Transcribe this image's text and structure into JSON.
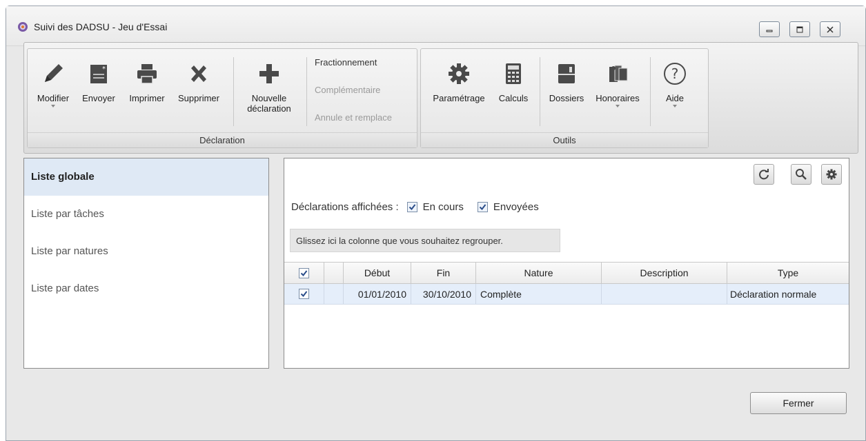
{
  "window": {
    "title": "Suivi des DADSU - Jeu d'Essai"
  },
  "ribbon": {
    "declaration_group": {
      "label": "Déclaration",
      "modifier": "Modifier",
      "envoyer": "Envoyer",
      "imprimer": "Imprimer",
      "supprimer": "Supprimer",
      "nouvelle_line1": "Nouvelle",
      "nouvelle_line2": "déclaration",
      "fractionnement": "Fractionnement",
      "complementaire": "Complémentaire",
      "annule_remplace": "Annule et remplace"
    },
    "outils_group": {
      "label": "Outils",
      "parametrage": "Paramétrage",
      "calculs": "Calculs",
      "dossiers": "Dossiers",
      "honoraires": "Honoraires",
      "aide": "Aide"
    }
  },
  "left_list": {
    "items": [
      {
        "label": "Liste globale",
        "active": true
      },
      {
        "label": "Liste par tâches",
        "active": false
      },
      {
        "label": "Liste par natures",
        "active": false
      },
      {
        "label": "Liste par dates",
        "active": false
      }
    ]
  },
  "filters": {
    "label": "Déclarations affichées :",
    "en_cours": "En cours",
    "envoyees": "Envoyées"
  },
  "group_zone": {
    "text": "Glissez ici la colonne que vous souhaitez regrouper."
  },
  "grid": {
    "headers": {
      "debut": "Début",
      "fin": "Fin",
      "nature": "Nature",
      "description": "Description",
      "type": "Type"
    },
    "rows": [
      {
        "checked": true,
        "debut": "01/01/2010",
        "fin": "30/10/2010",
        "nature": "Complète",
        "description": "",
        "type": "Déclaration normale"
      }
    ]
  },
  "footer": {
    "close_label": "Fermer"
  },
  "colors": {
    "accent_selection": "#dfe9f5",
    "row_selected": "#e5eefa"
  }
}
